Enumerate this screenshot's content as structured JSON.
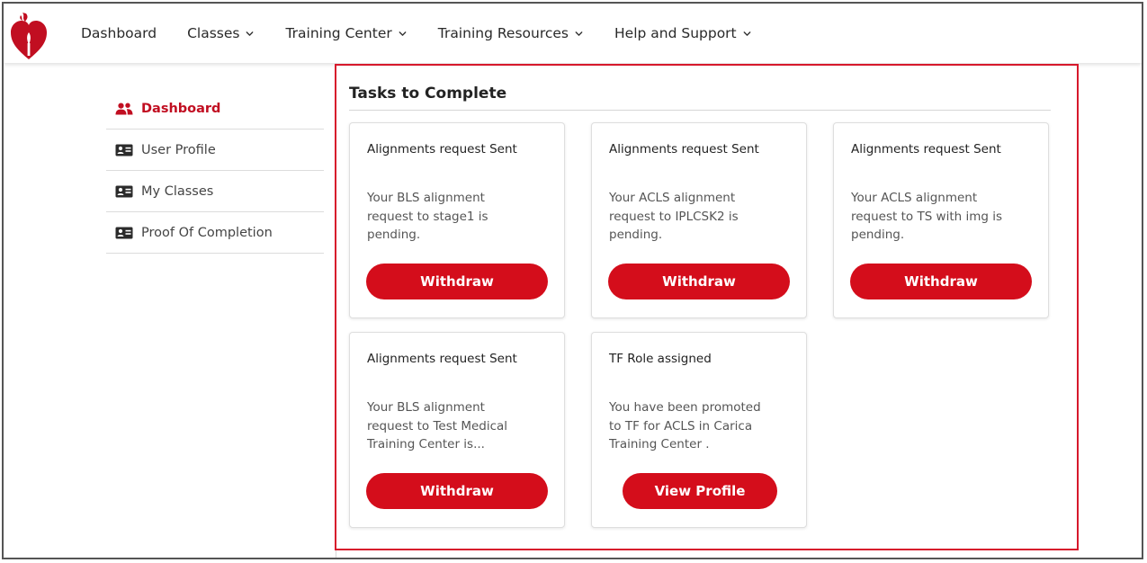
{
  "nav": {
    "items": [
      {
        "label": "Dashboard",
        "has_dropdown": false
      },
      {
        "label": "Classes",
        "has_dropdown": true
      },
      {
        "label": "Training Center",
        "has_dropdown": true
      },
      {
        "label": "Training Resources",
        "has_dropdown": true
      },
      {
        "label": "Help and Support",
        "has_dropdown": true
      }
    ]
  },
  "sidebar": {
    "items": [
      {
        "label": "Dashboard",
        "icon": "users-icon",
        "active": true
      },
      {
        "label": "User Profile",
        "icon": "id-card-icon",
        "active": false
      },
      {
        "label": "My Classes",
        "icon": "id-card-icon",
        "active": false
      },
      {
        "label": "Proof Of Completion",
        "icon": "id-card-icon",
        "active": false
      }
    ]
  },
  "tasks": {
    "title": "Tasks to Complete",
    "cards": [
      {
        "title": "Alignments request Sent",
        "lines": [
          "Your BLS alignment",
          "request to stage1 is",
          "pending."
        ],
        "button": "Withdraw"
      },
      {
        "title": "Alignments request Sent",
        "lines": [
          "Your ACLS alignment",
          "request to IPLCSK2 is",
          "pending."
        ],
        "button": "Withdraw"
      },
      {
        "title": "Alignments request Sent",
        "lines": [
          "Your ACLS alignment",
          "request to TS with img is",
          "pending."
        ],
        "button": "Withdraw"
      },
      {
        "title": "Alignments request Sent",
        "lines": [
          "Your BLS alignment",
          "request to Test Medical",
          "Training Center is..."
        ],
        "button": "Withdraw"
      },
      {
        "title": "TF Role assigned",
        "lines": [
          "You have been promoted",
          "to TF for ACLS in Carica",
          "Training Center ."
        ],
        "button": "View Profile"
      }
    ]
  },
  "colors": {
    "brand_red": "#c10e21",
    "button_red": "#d40d1b",
    "highlight_border": "#d7192c"
  }
}
